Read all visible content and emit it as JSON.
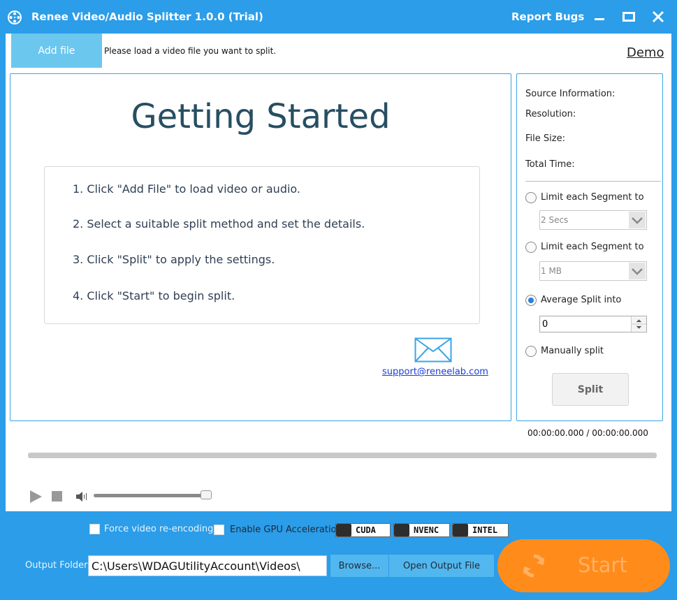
{
  "window": {
    "title": "Renee Video/Audio Splitter 1.0.0 (Trial)",
    "report_bugs": "Report Bugs"
  },
  "toolbar": {
    "add_file": "Add file",
    "hint": "Please load a video file you want to split.",
    "demo": "Demo"
  },
  "getting_started": {
    "title": "Getting Started",
    "steps": [
      "1. Click \"Add File\" to load video or audio.",
      "2. Select a suitable split method and set the details.",
      "3. Click \"Split\" to apply the settings.",
      "4. Click \"Start\" to begin split."
    ],
    "support_email": "support@reneelab.com"
  },
  "source_info": {
    "header": "Source Information:",
    "resolution": "Resolution:",
    "file_size": "File Size:",
    "total_time": "Total Time:"
  },
  "split_options": {
    "limit_time_label": "Limit each Segment to",
    "limit_time_value": "2 Secs",
    "limit_size_label": "Limit each Segment to",
    "limit_size_value": "1 MB",
    "average_label": "Average Split into",
    "average_value": "0",
    "manual_label": "Manually split",
    "selected": "average",
    "split_button": "Split"
  },
  "player": {
    "time": "00:00:00.000 / 00:00:00.000",
    "progress": 0,
    "volume": 1.0
  },
  "bottom": {
    "force_reencode": "Force video re-encoding",
    "gpu_accel": "Enable GPU Acceleration",
    "gpu_badges": [
      "CUDA",
      "NVENC",
      "INTEL"
    ],
    "output_label": "Output Folder:",
    "output_path": "C:\\Users\\WDAGUtilityAccount\\Videos\\",
    "browse": "Browse...",
    "open_output": "Open Output File",
    "start": "Start"
  },
  "colors": {
    "accent": "#2b9de9",
    "start": "#ff8c1a",
    "title_text": "#274e63"
  }
}
